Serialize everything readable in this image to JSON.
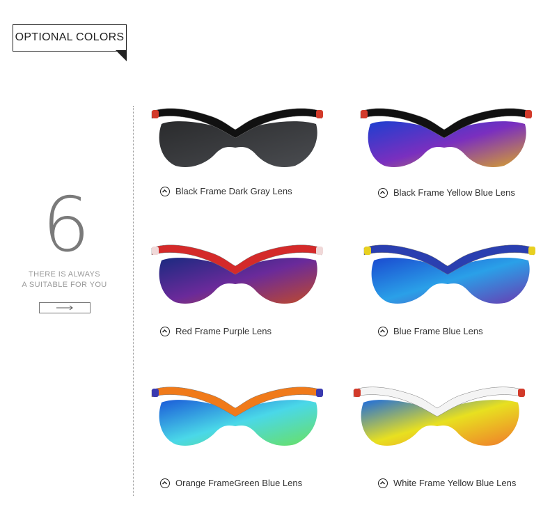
{
  "header": {
    "title": "OPTIONAL COLORS"
  },
  "sidebar": {
    "number": "6",
    "tagline_line1": "THERE IS ALWAYS",
    "tagline_line2": "A SUITABLE FOR YOU",
    "arrow_icon": "arrow-right-icon"
  },
  "products": [
    {
      "label": "Black Frame Dark Gray Lens",
      "frame_color": "#111111",
      "accent_color": "#d23a2a",
      "lens_colors": [
        "#2a2b2d",
        "#4a4c50"
      ]
    },
    {
      "label": "Black Frame Yellow Blue Lens",
      "frame_color": "#111111",
      "accent_color": "#d23a2a",
      "lens_colors": [
        "#1d3fd0",
        "#7a2fbf",
        "#d9a32a"
      ]
    },
    {
      "label": "Red Frame Purple Lens",
      "frame_color": "#d42a2a",
      "accent_color": "#f0d8d8",
      "lens_colors": [
        "#1a2a80",
        "#6a2a9a",
        "#c04a2a"
      ]
    },
    {
      "label": "Blue Frame Blue Lens",
      "frame_color": "#2a3fb0",
      "accent_color": "#e8d020",
      "lens_colors": [
        "#1a4ad0",
        "#2aa0e8",
        "#6a3ab0"
      ]
    },
    {
      "label": "Orange FrameGreen Blue Lens",
      "frame_color": "#f07a1a",
      "accent_color": "#3a3ab0",
      "lens_colors": [
        "#1a5ad8",
        "#4ad8e8",
        "#6ae060"
      ]
    },
    {
      "label": "White Frame Yellow Blue Lens",
      "frame_color": "#f4f4f4",
      "accent_color": "#d23a2a",
      "lens_colors": [
        "#1a6ae0",
        "#e8e020",
        "#f07a2a"
      ]
    }
  ],
  "icons": {
    "caption_icon": "chevron-up-circle-icon"
  }
}
